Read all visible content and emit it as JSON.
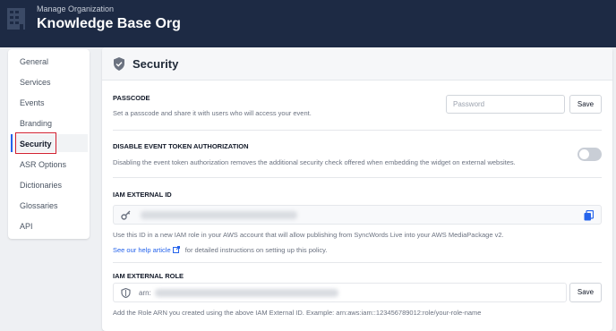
{
  "header": {
    "subtitle": "Manage Organization",
    "title": "Knowledge Base Org"
  },
  "sidebar": {
    "items": [
      {
        "label": "General"
      },
      {
        "label": "Services"
      },
      {
        "label": "Events"
      },
      {
        "label": "Branding"
      },
      {
        "label": "Security"
      },
      {
        "label": "ASR Options"
      },
      {
        "label": "Dictionaries"
      },
      {
        "label": "Glossaries"
      },
      {
        "label": "API"
      }
    ],
    "active": "Security"
  },
  "main": {
    "title": "Security",
    "passcode": {
      "label": "PASSCODE",
      "description": "Set a passcode and share it with users who will access your event.",
      "placeholder": "Password",
      "save_label": "Save"
    },
    "token_auth": {
      "label": "DISABLE EVENT TOKEN AUTHORIZATION",
      "description": "Disabling the event token authorization removes the additional security check offered when embedding the widget on external websites.",
      "enabled": false
    },
    "iam_id": {
      "label": "IAM EXTERNAL ID",
      "description": "Use this ID in a new IAM role in your AWS account that will allow publishing from SyncWords Live into your AWS MediaPackage v2.",
      "link_text": "See our help article",
      "link_suffix": "for detailed instructions on setting up this policy."
    },
    "iam_role": {
      "label": "IAM EXTERNAL ROLE",
      "value_prefix": "arn:",
      "save_label": "Save",
      "description": "Add the Role ARN you created using the above IAM External ID. Example: arn:aws:iam::123456789012:role/your-role-name"
    }
  },
  "colors": {
    "topbar": "#1d2a44",
    "accent": "#2563eb",
    "highlight": "#d11f2f"
  }
}
